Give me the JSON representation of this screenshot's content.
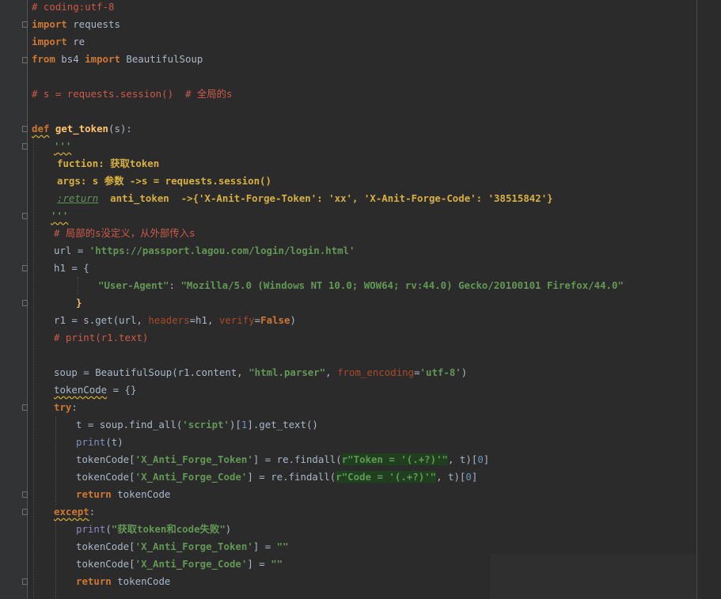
{
  "code": {
    "l1": "# coding:utf-8",
    "l2_kw": "import",
    "l2_mod": " requests",
    "l3_kw": "import",
    "l3_mod": " re",
    "l4_kw1": "from",
    "l4_mod": " bs4 ",
    "l4_kw2": "import",
    "l4_cls": " BeautifulSoup",
    "l6": "# s = requests.session()  # 全局的s",
    "l8_kw": "def",
    "l8_fn": "get_token",
    "l8_p1": "(",
    "l8_arg": "s",
    "l8_p2": "):",
    "l9": "'''",
    "l10": "fuction: 获取token",
    "l11": "args: s 参数 ->s = requests.session()",
    "l12_tag": ":return",
    "l12_rest": "  anti_token  ->{'X-Anit-Forge-Token': 'xx', 'X-Anit-Forge-Code': '38515842'}",
    "l13": "'''",
    "l14": "# 局部的s没定义，从外部传入s",
    "l15_a": "url = ",
    "l15_s": "'https://passport.lagou.com/login/login.html'",
    "l16_a": "h1 = {",
    "l17_k": "\"User-Agent\"",
    "l17_c": ": ",
    "l17_v": "\"Mozilla/5.0 (Windows NT 10.0; WOW64; rv:44.0) Gecko/20100101 Firefox/44.0\"",
    "l18": "}",
    "l19_a": "r1 = s.get(url, ",
    "l19_k1": "headers",
    "l19_b": "=h1, ",
    "l19_k2": "verify",
    "l19_c": "=",
    "l19_v": "False",
    "l19_d": ")",
    "l20": "# print(r1.text)",
    "l22_a": "soup = BeautifulSoup(r1.content, ",
    "l22_s1": "\"html.parser\"",
    "l22_b": ", ",
    "l22_k": "from_encoding",
    "l22_c": "=",
    "l22_s2": "'utf-8'",
    "l22_d": ")",
    "l23_a": "tokenCode",
    "l23_b": " = {}",
    "l24": "try",
    "l24_c": ":",
    "l25_a": "t = soup.find_all(",
    "l25_s": "'script'",
    "l25_b": ")[",
    "l25_n": "1",
    "l25_c": "].get_text()",
    "l26_f": "print",
    "l26_r": "(t)",
    "l27_a": "tokenCode[",
    "l27_s1": "'X_Anti_Forge_Token'",
    "l27_b": "] = re.findall(",
    "l27_r": "r\"Token = '(.+?)'\"",
    "l27_c": ", t)[",
    "l27_n": "0",
    "l27_d": "]",
    "l28_a": "tokenCode[",
    "l28_s1": "'X_Anti_Forge_Code'",
    "l28_b": "] = re.findall(",
    "l28_r": "r\"Code = '(.+?)'\"",
    "l28_c": ", t)[",
    "l28_n": "0",
    "l28_d": "]",
    "l29_kw": "return",
    "l29_r": " tokenCode",
    "l30": "except",
    "l30_c": ":",
    "l31_f": "print",
    "l31_a": "(",
    "l31_s": "\"获取token和code失败\"",
    "l31_b": ")",
    "l32_a": "tokenCode[",
    "l32_s1": "'X_Anti_Forge_Token'",
    "l32_b": "] = ",
    "l32_s2": "\"\"",
    "l33_a": "tokenCode[",
    "l33_s1": "'X_Anti_Forge_Code'",
    "l33_b": "] = ",
    "l33_s2": "\"\"",
    "l34_kw": "return",
    "l34_r": " tokenCode"
  },
  "colors": {
    "background": "#2b2b2b",
    "gutter": "#313335",
    "keyword": "#cc7832",
    "string": "#6a8759",
    "comment": "#cc5a4a",
    "function": "#ffc66d",
    "number": "#6897bb",
    "builtin": "#8888c6"
  }
}
